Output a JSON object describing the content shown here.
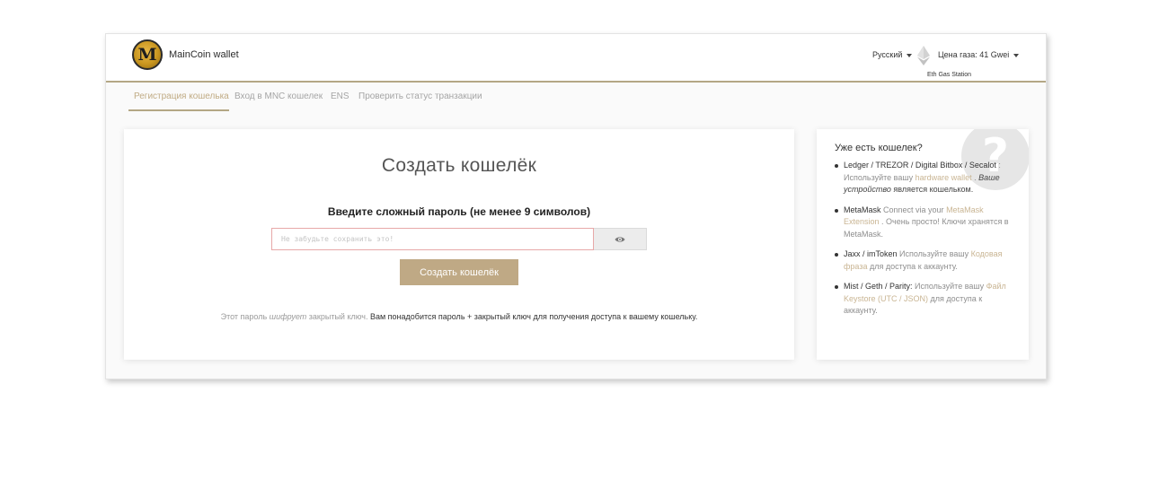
{
  "header": {
    "brand": "MainCoin wallet",
    "logo_letter": "M",
    "language": "Русский",
    "gas_price": "Цена газа: 41 Gwei",
    "gas_station": "Eth Gas Station"
  },
  "nav": {
    "items": [
      {
        "label": "Регистрация кошелька",
        "active": true
      },
      {
        "label": "Вход в MNC кошелек",
        "active": false
      },
      {
        "label": "ENS",
        "active": false
      },
      {
        "label": "Проверить статус транзакции",
        "active": false
      }
    ]
  },
  "create": {
    "title": "Создать кошелёк",
    "subtitle": "Введите сложный пароль (не менее 9 символов)",
    "password_placeholder": "Не забудьте сохранить это!",
    "password_value": "",
    "button": "Создать кошелёк",
    "note": {
      "part1": "Этот пароль ",
      "part2": "шифрует",
      "part3": " закрытый ключ. ",
      "part4": "Вам понадобится пароль + закрытый ключ для получения доступа к вашему кошельку."
    }
  },
  "sidebar": {
    "title": "Уже есть кошелек?",
    "items": [
      {
        "name": "Ledger / TREZOR / Digital Bitbox / Secalot",
        "text1": " : Используйте вашу ",
        "link": "hardware wallet",
        "text2": " . ",
        "text3": "Ваше устройство",
        "text4": " является кошельком."
      },
      {
        "name": "MetaMask",
        "text1": " Connect via your ",
        "link": "MetaMask Extension",
        "text2": " . Очень просто! Ключи хранятся в MetaMask."
      },
      {
        "name": "Jaxx / imToken",
        "text1": " Используйте вашу ",
        "link": "Кодовая фраза",
        "text2": " для доступа к аккаунту."
      },
      {
        "name": "Mist / Geth / Parity:",
        "text1": " Используйте вашу ",
        "link": "Файл Keystore (UTC / JSON)",
        "text2": " для доступа к аккаунту."
      }
    ]
  },
  "colors": {
    "accent": "#b4a785",
    "button": "#bfa985",
    "link": "#c9b593",
    "input_border": "#e7a8a8"
  }
}
